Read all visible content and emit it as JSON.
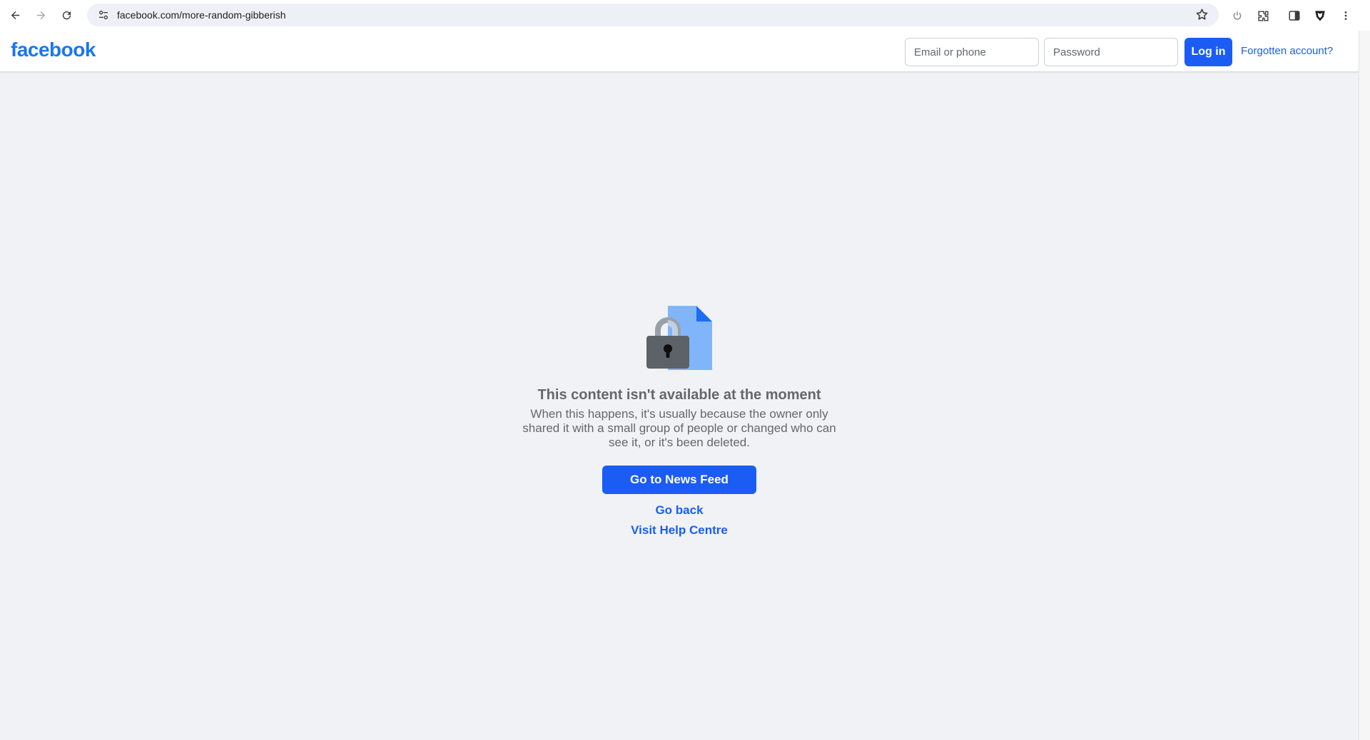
{
  "browser": {
    "url": "facebook.com/more-random-gibberish",
    "icons": [
      "back-arrow-icon",
      "forward-arrow-icon",
      "reload-icon",
      "site-settings-icon",
      "bookmark-star-icon",
      "power-icon",
      "extensions-icon",
      "side-panel-icon",
      "brave-shield-icon",
      "more-vertical-icon"
    ]
  },
  "header": {
    "logo": "facebook",
    "email_placeholder": "Email or phone",
    "password_placeholder": "Password",
    "login_label": "Log in",
    "forgot_label": "Forgotten account?"
  },
  "main": {
    "illustration": "lock-document-icon",
    "title": "This content isn't available at the moment",
    "description": "When this happens, it's usually because the owner only shared it with a small group of people or changed who can see it, or it's been deleted.",
    "news_feed_label": "Go to News Feed",
    "go_back_label": "Go back",
    "help_label": "Visit Help Centre"
  },
  "colors": {
    "brand": "#1877f2",
    "button": "#1b5cf5",
    "background": "#f0f2f5",
    "secondary_text": "#65676b"
  }
}
